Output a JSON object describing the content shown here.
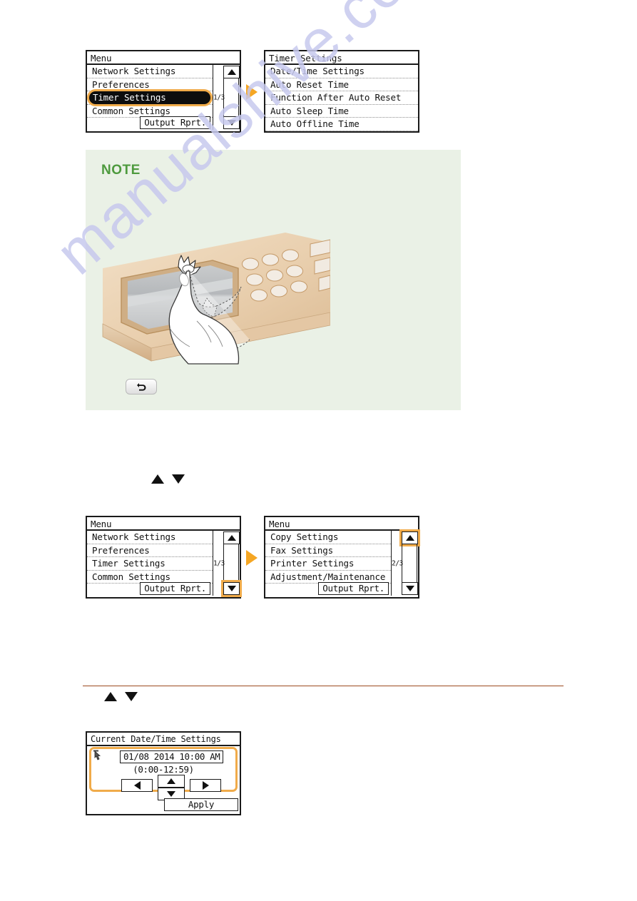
{
  "watermark": {
    "text": "manualshive.com",
    "color": "#c7c9ee"
  },
  "colors": {
    "accent_orange": "#f0ab4a",
    "flow_arrow": "#f5a623",
    "note_bg": "#eaf1e6",
    "note_green": "#4e9a3e",
    "rule_brown": "#9c4a20",
    "lcd_border": "#1a1a1a"
  },
  "step1": {
    "left_screen": {
      "title": "Menu",
      "rows": [
        {
          "label": "Network Settings",
          "selected": false
        },
        {
          "label": "Preferences",
          "selected": false
        },
        {
          "label": "Timer Settings",
          "selected": true
        },
        {
          "label": "Common Settings",
          "selected": false
        }
      ],
      "page_indicator": "1/3",
      "output_button": "Output Rprt.",
      "scroll_up_highlighted": false,
      "scroll_down_highlighted": false
    },
    "right_screen": {
      "title": "Timer Settings",
      "rows": [
        {
          "label": "Date/Time Settings",
          "selected": false
        },
        {
          "label": "Auto Reset Time",
          "selected": false
        },
        {
          "label": "Function After Auto Reset",
          "selected": false
        },
        {
          "label": "Auto Sleep Time",
          "selected": false
        },
        {
          "label": "Auto Offline Time",
          "selected": false
        }
      ]
    }
  },
  "note": {
    "title": "NOTE",
    "illustration_name": "finger-tapping-control-panel",
    "back_button_glyph": "↶"
  },
  "mid_arrows": {
    "up": "▲",
    "down": "▼"
  },
  "step2": {
    "left_screen": {
      "title": "Menu",
      "rows": [
        {
          "label": "Network Settings",
          "selected": false
        },
        {
          "label": "Preferences",
          "selected": false
        },
        {
          "label": "Timer Settings",
          "selected": false
        },
        {
          "label": "Common Settings",
          "selected": false
        }
      ],
      "page_indicator": "1/3",
      "output_button": "Output Rprt.",
      "scroll_up_highlighted": false,
      "scroll_down_highlighted": true
    },
    "right_screen": {
      "title": "Menu",
      "rows": [
        {
          "label": "Copy Settings",
          "selected": false
        },
        {
          "label": "Fax Settings",
          "selected": false
        },
        {
          "label": "Printer Settings",
          "selected": false
        },
        {
          "label": "Adjustment/Maintenance",
          "selected": false
        }
      ],
      "page_indicator": "2/3",
      "output_button": "Output Rprt.",
      "scroll_up_highlighted": true,
      "scroll_down_highlighted": false
    }
  },
  "bottom_arrows": {
    "up": "▲",
    "down": "▼"
  },
  "step3": {
    "screen": {
      "title": "Current Date/Time Settings",
      "value": "01/08 2014 10:00 AM",
      "range": "(0:00-12:59)",
      "left_arrow": "◀",
      "right_arrow": "▶",
      "up_arrow": "▲",
      "down_arrow": "▼",
      "apply_button": "Apply"
    }
  }
}
